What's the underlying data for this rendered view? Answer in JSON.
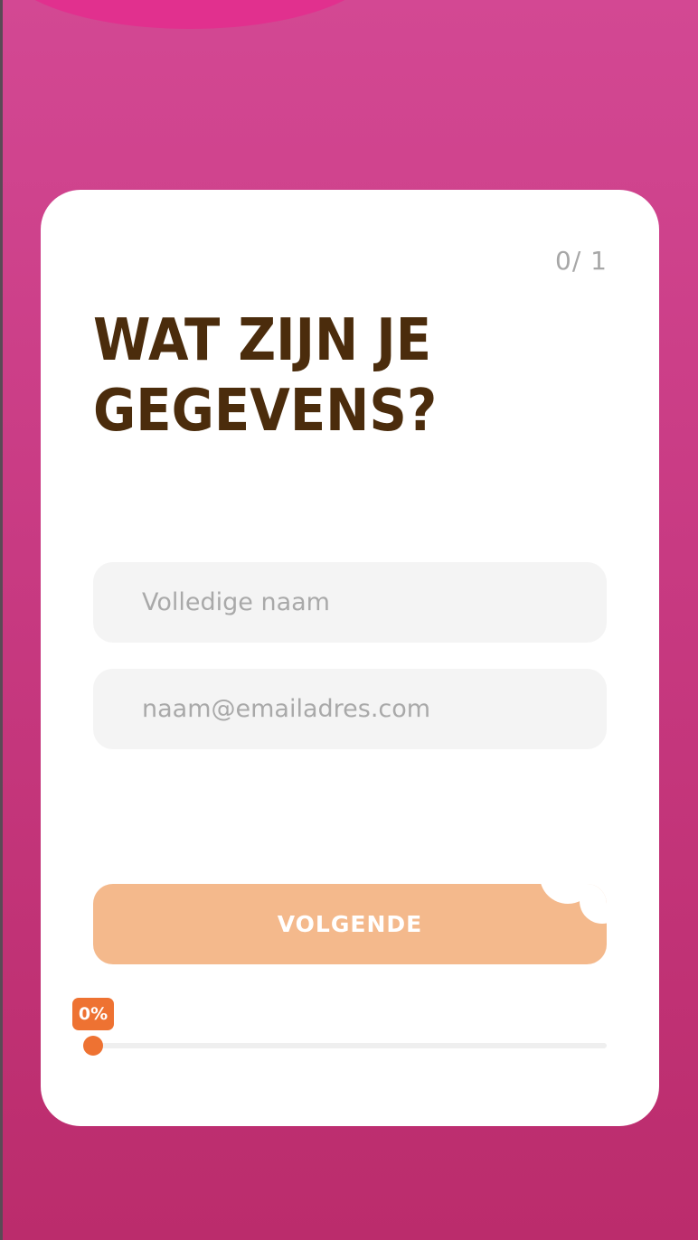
{
  "form": {
    "step_counter": "0/ 1",
    "title": "Wat zijn je gegevens?",
    "name_field": {
      "value": "",
      "placeholder": "Volledige naam"
    },
    "email_field": {
      "value": "",
      "placeholder": "naam@emailadres.com"
    },
    "next_button_label": "VOLGENDE"
  },
  "progress": {
    "label": "0%",
    "value": 0
  },
  "colors": {
    "background_top": "#d34893",
    "background_bottom": "#bb2c6c",
    "title": "#4b2c0c",
    "button": "#f4b98c",
    "accent": "#ee7232"
  }
}
